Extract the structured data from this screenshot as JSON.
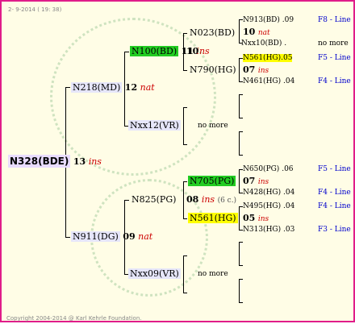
{
  "header_date": "2- 9-2014 ( 19: 38)",
  "root": {
    "id": "N328(BDE)",
    "year": "13",
    "note": "ins"
  },
  "sire": {
    "id": "N218(MD)",
    "year": "12",
    "note": "nat"
  },
  "dam": {
    "id": "N911(DG)",
    "year": "09",
    "note": "nat"
  },
  "sire_sire": {
    "id": "N100(BD)",
    "year": "11",
    "note": "ins"
  },
  "sire_dam": {
    "id": "Nxx12(VR)",
    "more": "no more"
  },
  "dam_sire": {
    "id": "N825(PG)",
    "year": "08",
    "note": "ins",
    "extra": "(6 c.)"
  },
  "dam_dam": {
    "id": "Nxx09(VR)",
    "more": "no more"
  },
  "g3": {
    "a": {
      "id": "N023(BD)",
      "year": "10",
      "note": "nat"
    },
    "b": {
      "id": "N790(HG)",
      "year": "07",
      "note": "ins"
    },
    "c": {
      "id": "N705(PG)",
      "year": "07",
      "note": "ins"
    },
    "d": {
      "id": "N561(HG)",
      "year": "05",
      "note": "ins"
    }
  },
  "g4": [
    {
      "id": "N913(BD)",
      "pct": ".09",
      "line": "F8 - Line"
    },
    {
      "id": "Nxx10(BD)",
      "pct": ".",
      "line": "no more"
    },
    {
      "id": "N561(HG)",
      "pct": ".05",
      "line": "F5 - Line"
    },
    {
      "id": "N461(HG)",
      "pct": ".04",
      "line": "F4 - Line"
    },
    {
      "id": "N650(PG)",
      "pct": ".06",
      "line": "F5 - Line"
    },
    {
      "id": "N428(HG)",
      "pct": ".04",
      "line": "F4 - Line"
    },
    {
      "id": "N495(HG)",
      "pct": ".04",
      "line": "F4 - Line"
    },
    {
      "id": "N313(HG)",
      "pct": ".03",
      "line": "F3 - Line"
    }
  ],
  "copyright": "Copyright 2004-2014 @ Karl Kehrle Foundation."
}
